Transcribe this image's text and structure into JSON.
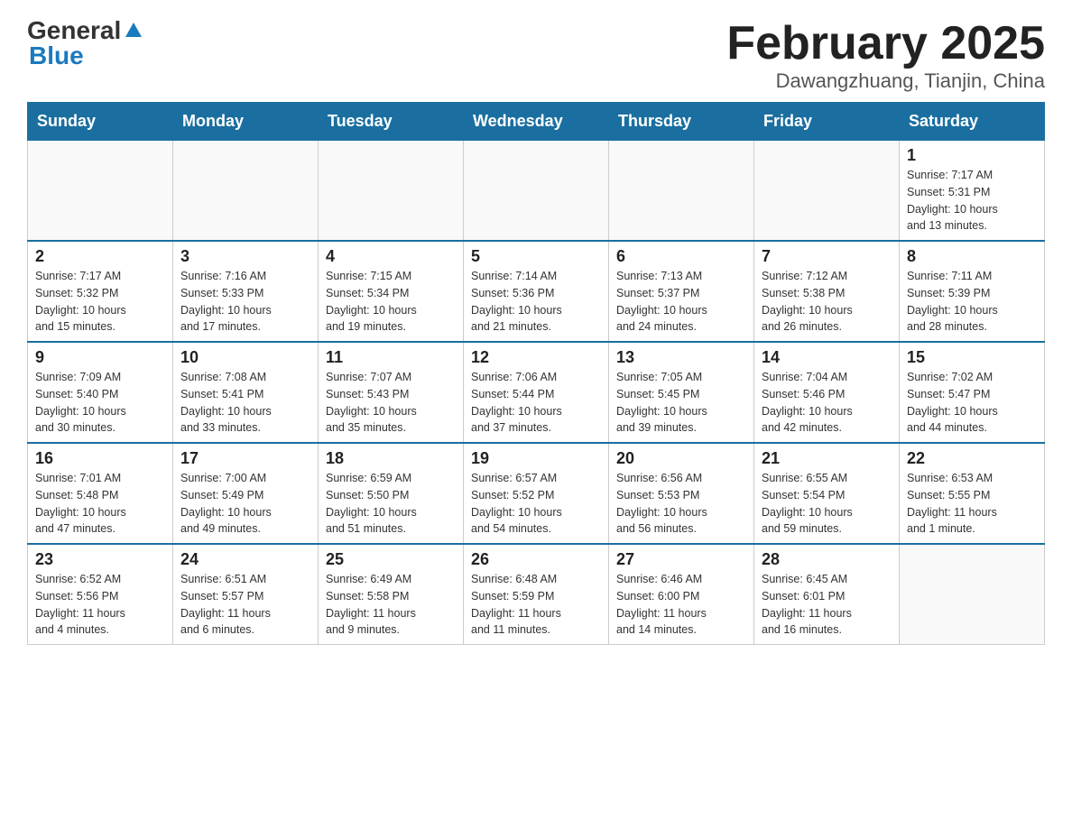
{
  "logo": {
    "general": "General",
    "blue": "Blue"
  },
  "title": "February 2025",
  "location": "Dawangzhuang, Tianjin, China",
  "days_of_week": [
    "Sunday",
    "Monday",
    "Tuesday",
    "Wednesday",
    "Thursday",
    "Friday",
    "Saturday"
  ],
  "weeks": [
    [
      {
        "day": "",
        "info": ""
      },
      {
        "day": "",
        "info": ""
      },
      {
        "day": "",
        "info": ""
      },
      {
        "day": "",
        "info": ""
      },
      {
        "day": "",
        "info": ""
      },
      {
        "day": "",
        "info": ""
      },
      {
        "day": "1",
        "info": "Sunrise: 7:17 AM\nSunset: 5:31 PM\nDaylight: 10 hours\nand 13 minutes."
      }
    ],
    [
      {
        "day": "2",
        "info": "Sunrise: 7:17 AM\nSunset: 5:32 PM\nDaylight: 10 hours\nand 15 minutes."
      },
      {
        "day": "3",
        "info": "Sunrise: 7:16 AM\nSunset: 5:33 PM\nDaylight: 10 hours\nand 17 minutes."
      },
      {
        "day": "4",
        "info": "Sunrise: 7:15 AM\nSunset: 5:34 PM\nDaylight: 10 hours\nand 19 minutes."
      },
      {
        "day": "5",
        "info": "Sunrise: 7:14 AM\nSunset: 5:36 PM\nDaylight: 10 hours\nand 21 minutes."
      },
      {
        "day": "6",
        "info": "Sunrise: 7:13 AM\nSunset: 5:37 PM\nDaylight: 10 hours\nand 24 minutes."
      },
      {
        "day": "7",
        "info": "Sunrise: 7:12 AM\nSunset: 5:38 PM\nDaylight: 10 hours\nand 26 minutes."
      },
      {
        "day": "8",
        "info": "Sunrise: 7:11 AM\nSunset: 5:39 PM\nDaylight: 10 hours\nand 28 minutes."
      }
    ],
    [
      {
        "day": "9",
        "info": "Sunrise: 7:09 AM\nSunset: 5:40 PM\nDaylight: 10 hours\nand 30 minutes."
      },
      {
        "day": "10",
        "info": "Sunrise: 7:08 AM\nSunset: 5:41 PM\nDaylight: 10 hours\nand 33 minutes."
      },
      {
        "day": "11",
        "info": "Sunrise: 7:07 AM\nSunset: 5:43 PM\nDaylight: 10 hours\nand 35 minutes."
      },
      {
        "day": "12",
        "info": "Sunrise: 7:06 AM\nSunset: 5:44 PM\nDaylight: 10 hours\nand 37 minutes."
      },
      {
        "day": "13",
        "info": "Sunrise: 7:05 AM\nSunset: 5:45 PM\nDaylight: 10 hours\nand 39 minutes."
      },
      {
        "day": "14",
        "info": "Sunrise: 7:04 AM\nSunset: 5:46 PM\nDaylight: 10 hours\nand 42 minutes."
      },
      {
        "day": "15",
        "info": "Sunrise: 7:02 AM\nSunset: 5:47 PM\nDaylight: 10 hours\nand 44 minutes."
      }
    ],
    [
      {
        "day": "16",
        "info": "Sunrise: 7:01 AM\nSunset: 5:48 PM\nDaylight: 10 hours\nand 47 minutes."
      },
      {
        "day": "17",
        "info": "Sunrise: 7:00 AM\nSunset: 5:49 PM\nDaylight: 10 hours\nand 49 minutes."
      },
      {
        "day": "18",
        "info": "Sunrise: 6:59 AM\nSunset: 5:50 PM\nDaylight: 10 hours\nand 51 minutes."
      },
      {
        "day": "19",
        "info": "Sunrise: 6:57 AM\nSunset: 5:52 PM\nDaylight: 10 hours\nand 54 minutes."
      },
      {
        "day": "20",
        "info": "Sunrise: 6:56 AM\nSunset: 5:53 PM\nDaylight: 10 hours\nand 56 minutes."
      },
      {
        "day": "21",
        "info": "Sunrise: 6:55 AM\nSunset: 5:54 PM\nDaylight: 10 hours\nand 59 minutes."
      },
      {
        "day": "22",
        "info": "Sunrise: 6:53 AM\nSunset: 5:55 PM\nDaylight: 11 hours\nand 1 minute."
      }
    ],
    [
      {
        "day": "23",
        "info": "Sunrise: 6:52 AM\nSunset: 5:56 PM\nDaylight: 11 hours\nand 4 minutes."
      },
      {
        "day": "24",
        "info": "Sunrise: 6:51 AM\nSunset: 5:57 PM\nDaylight: 11 hours\nand 6 minutes."
      },
      {
        "day": "25",
        "info": "Sunrise: 6:49 AM\nSunset: 5:58 PM\nDaylight: 11 hours\nand 9 minutes."
      },
      {
        "day": "26",
        "info": "Sunrise: 6:48 AM\nSunset: 5:59 PM\nDaylight: 11 hours\nand 11 minutes."
      },
      {
        "day": "27",
        "info": "Sunrise: 6:46 AM\nSunset: 6:00 PM\nDaylight: 11 hours\nand 14 minutes."
      },
      {
        "day": "28",
        "info": "Sunrise: 6:45 AM\nSunset: 6:01 PM\nDaylight: 11 hours\nand 16 minutes."
      },
      {
        "day": "",
        "info": ""
      }
    ]
  ]
}
